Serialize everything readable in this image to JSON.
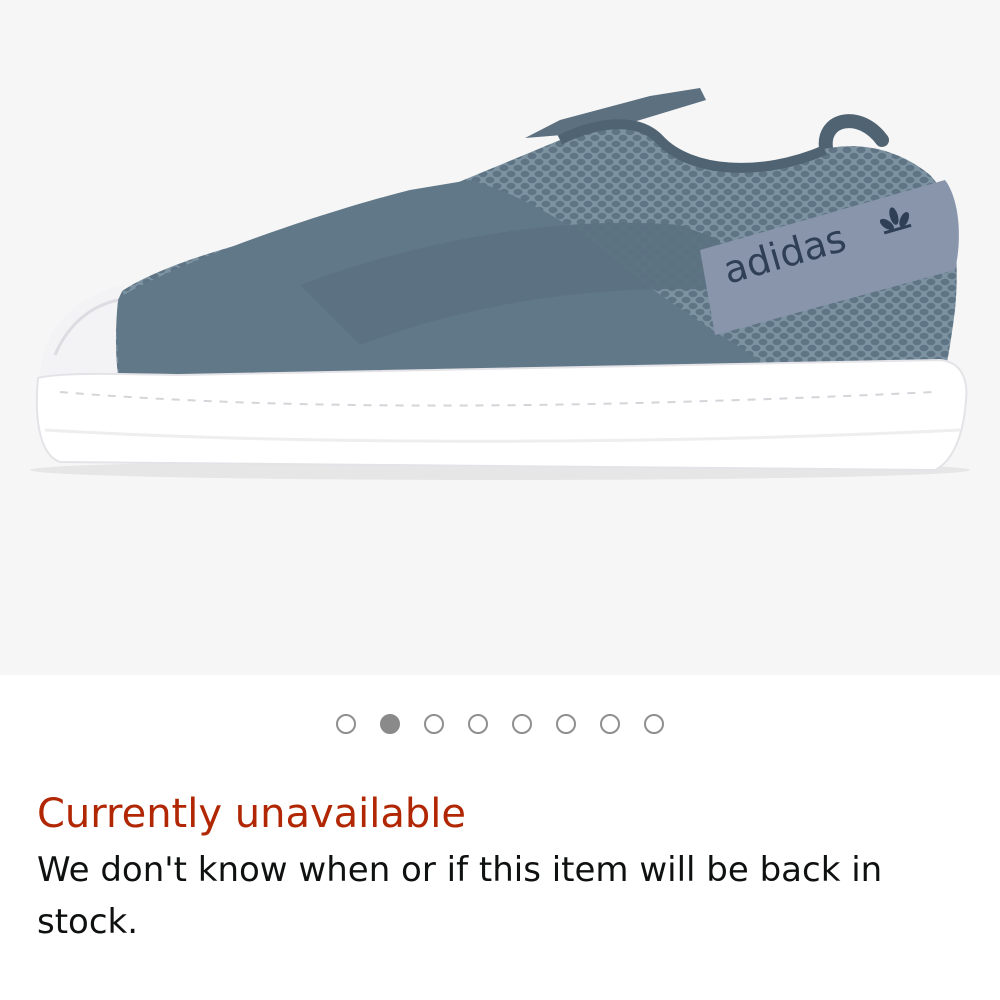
{
  "product_image": {
    "alt": "",
    "brand_logo_text": "adidas",
    "colors": {
      "upper": "#6e8494",
      "strap": "#5f7585",
      "mesh": "#7d93a2",
      "heel_tab": "#8895ab",
      "sole": "#ffffff",
      "background": "#f6f6f6"
    }
  },
  "carousel": {
    "total": 8,
    "active_index": 1
  },
  "availability": {
    "title": "Currently unavailable",
    "message": "We don't know when or if this item will be back in stock.",
    "title_color": "#b12704"
  }
}
